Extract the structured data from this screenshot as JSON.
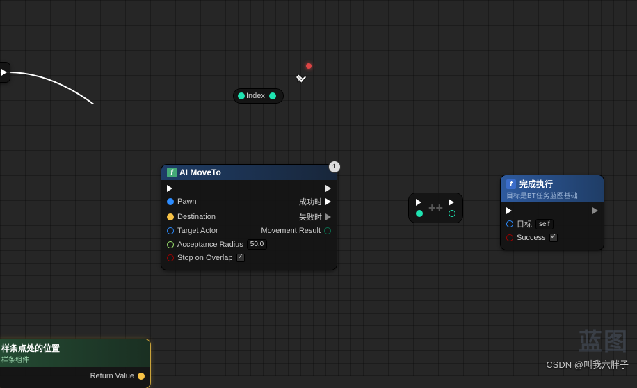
{
  "reroute": {
    "label": "Index"
  },
  "ai_moveto": {
    "title": "AI MoveTo",
    "inputs": {
      "pawn": "Pawn",
      "destination": "Destination",
      "target_actor": "Target Actor",
      "acceptance_radius": "Acceptance Radius",
      "acceptance_radius_value": "50.0",
      "stop_on_overlap": "Stop on Overlap"
    },
    "outputs": {
      "on_success": "成功时",
      "on_fail": "失败时",
      "movement_result": "Movement Result"
    }
  },
  "finish_execute": {
    "title": "完成执行",
    "subtitle": "目标是BT任务蓝图基础",
    "target_label": "目标",
    "target_value": "self",
    "success_label": "Success"
  },
  "spline_node": {
    "title": "样条点处的位置",
    "subtitle": "样条组件",
    "return_label": "Return Value"
  },
  "watermark": "CSDN @叫我六胖子",
  "watermark2": "蓝图",
  "colors": {
    "exec": "#ffffff",
    "int": "#1fe3b1",
    "object": "#2c8cff",
    "vector": "#f7c246",
    "bool": "#a00000",
    "enum": "#0b6e4f",
    "struct": "#0f4c81"
  }
}
